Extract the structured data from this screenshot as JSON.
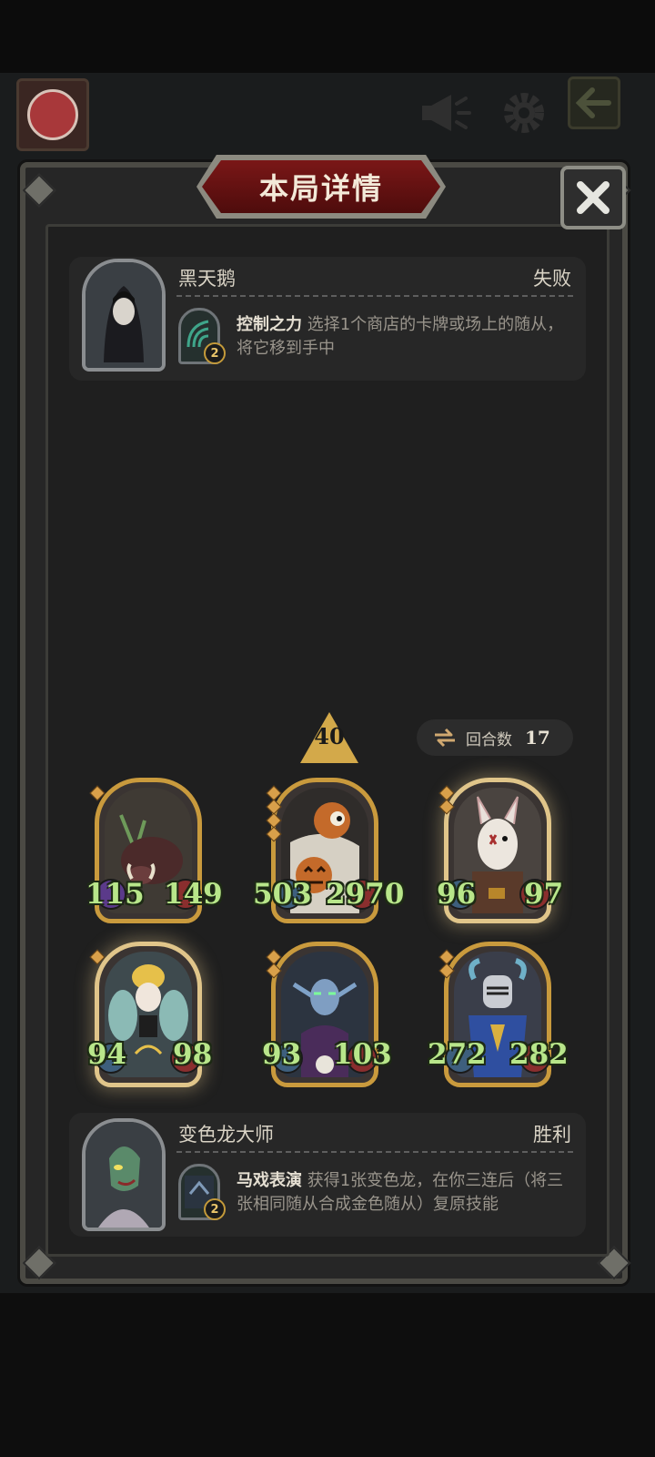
{
  "colors": {
    "title_red": "#7a1717",
    "stat_green": "#b8e68a",
    "gold_frame": "#c99a3d",
    "panel_bg": "#272727"
  },
  "top_bar": {
    "avatar": "player-avatar",
    "icons": [
      "megaphone-icon",
      "gear-icon",
      "back-icon"
    ]
  },
  "dialog": {
    "title": "本局详情",
    "close_icon": "close-icon"
  },
  "opponent": {
    "name": "黑天鹅",
    "result": "失败",
    "skill_cost": "2",
    "skill_name": "控制之力",
    "skill_desc": "选择1个商店的卡牌或场上的随从，将它移到手中"
  },
  "board": {
    "tier": "40",
    "rounds_label": "回合数",
    "rounds_value": "17",
    "minions": [
      {
        "name": "boar",
        "attack": "115",
        "health": "149",
        "stars": 1,
        "golden": false
      },
      {
        "name": "pumpkin-mummy",
        "attack": "503",
        "health": "2970",
        "stars": 4,
        "golden": false
      },
      {
        "name": "rabbit-mask-bandit",
        "attack": "96",
        "health": "97",
        "stars": 2,
        "golden": true
      },
      {
        "name": "fairy",
        "attack": "94",
        "health": "98",
        "stars": 1,
        "golden": true
      },
      {
        "name": "dark-elf-sorceress",
        "attack": "93",
        "health": "103",
        "stars": 2,
        "golden": false
      },
      {
        "name": "horned-knight",
        "attack": "272",
        "health": "282",
        "stars": 2,
        "golden": false
      }
    ]
  },
  "player": {
    "name": "变色龙大师",
    "result": "胜利",
    "skill_cost": "2",
    "skill_name": "马戏表演",
    "skill_desc": "获得1张变色龙，在你三连后（将三张相同随从合成金色随从）复原技能"
  }
}
